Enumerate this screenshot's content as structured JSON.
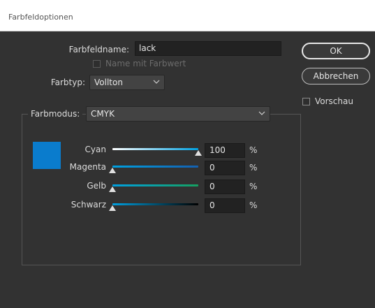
{
  "window": {
    "title": "Farbfeldoptionen"
  },
  "form": {
    "name_label": "Farbfeldname:",
    "name_value": "lack",
    "name_with_value_label": "Name mit Farbwert",
    "type_label": "Farbtyp:",
    "type_value": "Vollton",
    "mode_label": "Farbmodus:",
    "mode_value": "CMYK"
  },
  "buttons": {
    "ok": "OK",
    "cancel": "Abbrechen"
  },
  "preview": {
    "label": "Vorschau",
    "checked": false
  },
  "swatch": {
    "color": "#0a7ccd"
  },
  "sliders": [
    {
      "label": "Cyan",
      "value": "100",
      "unit": "%",
      "fraction": 1.0,
      "gradient": [
        "#ffffff",
        "#00a0e0"
      ]
    },
    {
      "label": "Magenta",
      "value": "0",
      "unit": "%",
      "fraction": 0.0,
      "gradient": [
        "#00a0e0",
        "#1460b0"
      ]
    },
    {
      "label": "Gelb",
      "value": "0",
      "unit": "%",
      "fraction": 0.0,
      "gradient": [
        "#00a0e0",
        "#15a060"
      ]
    },
    {
      "label": "Schwarz",
      "value": "0",
      "unit": "%",
      "fraction": 0.0,
      "gradient": [
        "#00a0e0",
        "#000000"
      ]
    }
  ]
}
